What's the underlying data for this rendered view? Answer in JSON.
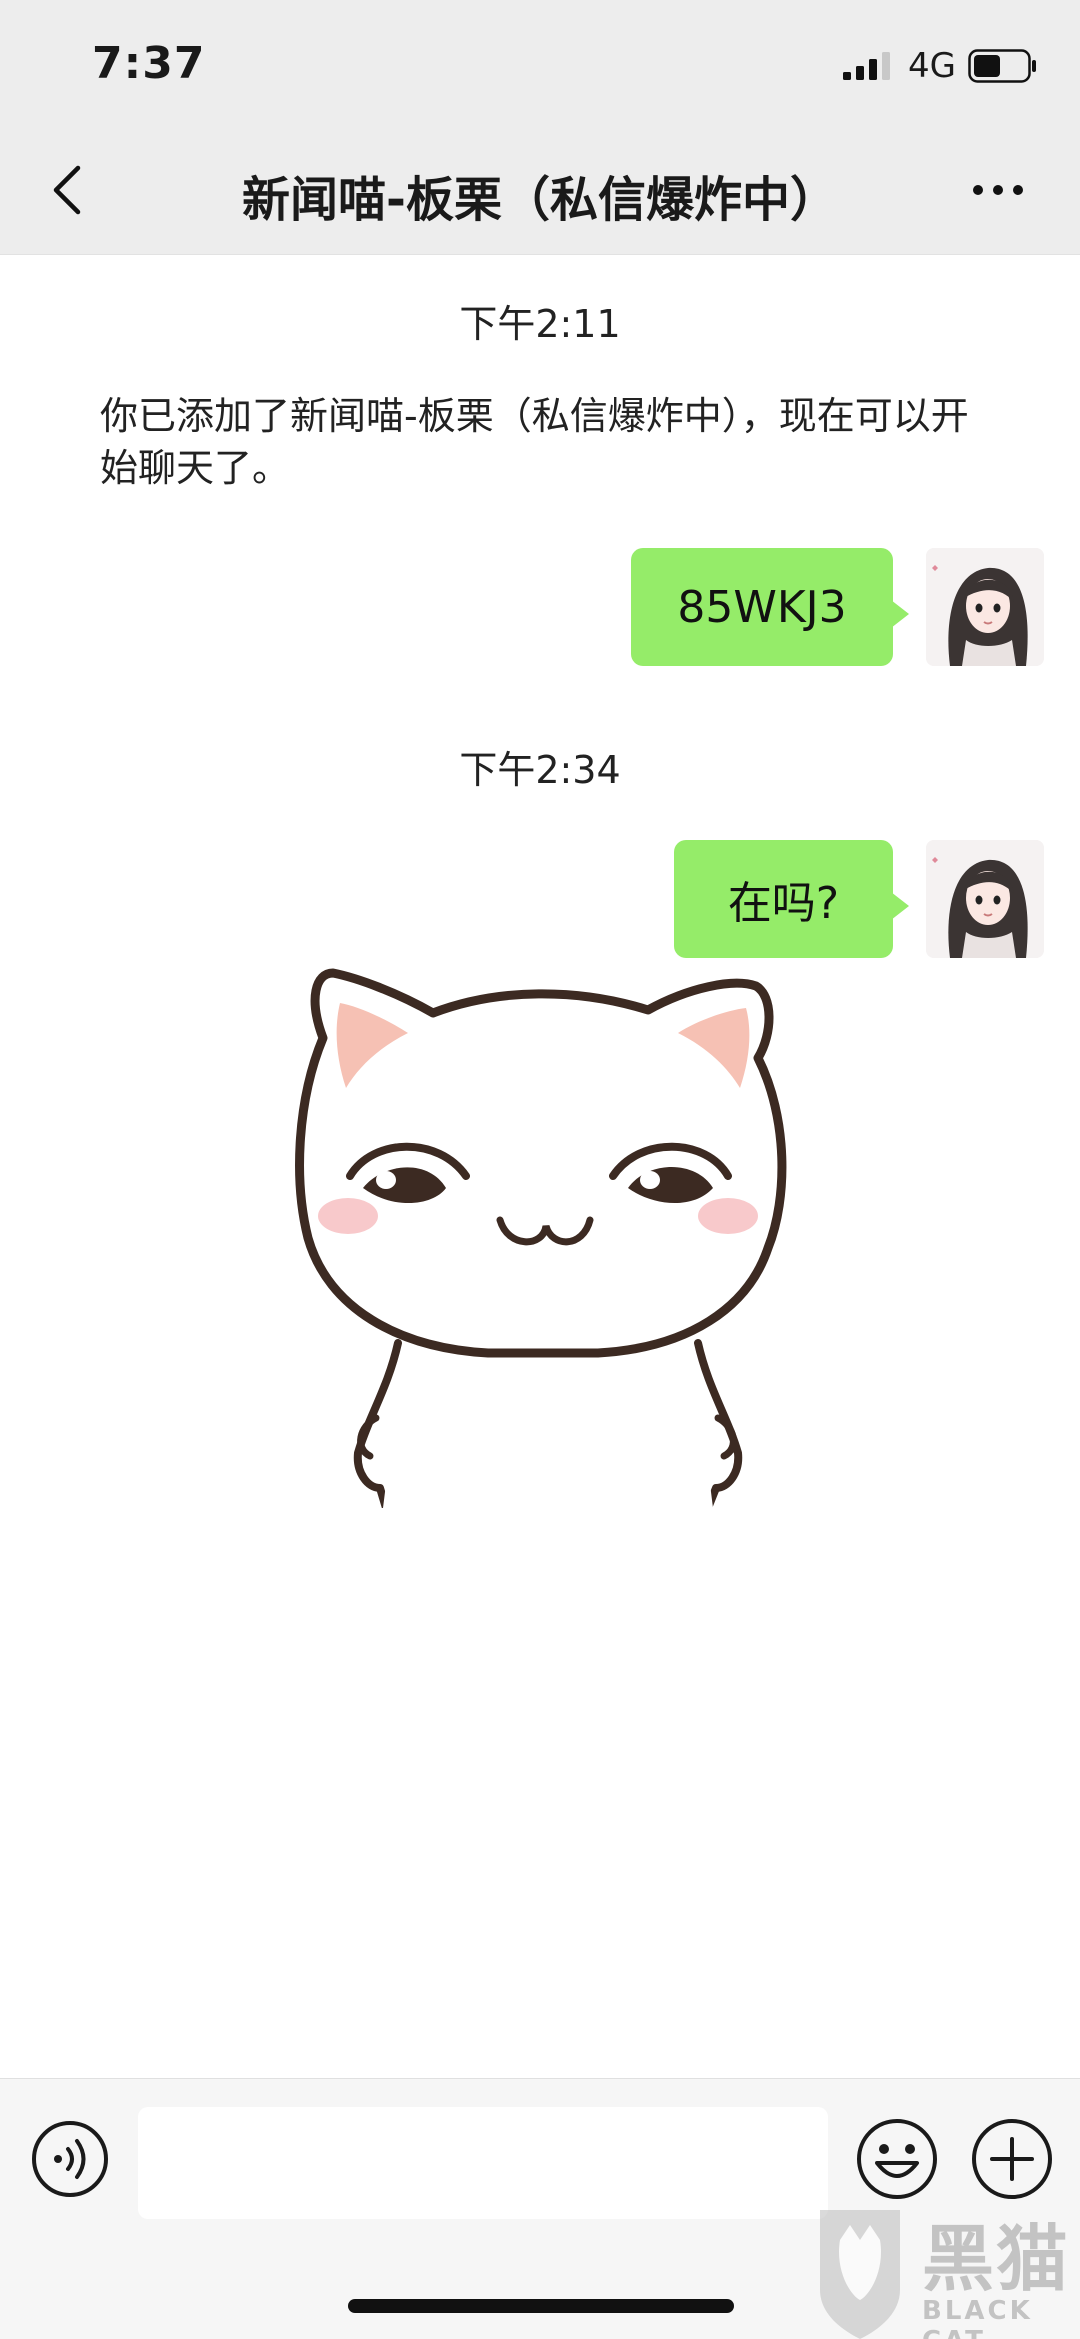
{
  "status_bar": {
    "time": "7:37",
    "network": "4G"
  },
  "nav": {
    "title": "新闻喵-板栗（私信爆炸中）"
  },
  "chat": {
    "timestamp_1": "下午2:11",
    "system_message": "你已添加了新闻喵-板栗（私信爆炸中），现在可以开始聊天了。",
    "message_1": "85WKJ3",
    "timestamp_2": "下午2:34",
    "message_2": "在吗?",
    "bubble_color": "#95ec69"
  },
  "input_bar": {
    "text_value": "",
    "icons": [
      "voice-icon",
      "emoji-icon",
      "plus-icon"
    ]
  },
  "watermark": {
    "main": "黑猫",
    "sub": "BLACK CAT"
  }
}
